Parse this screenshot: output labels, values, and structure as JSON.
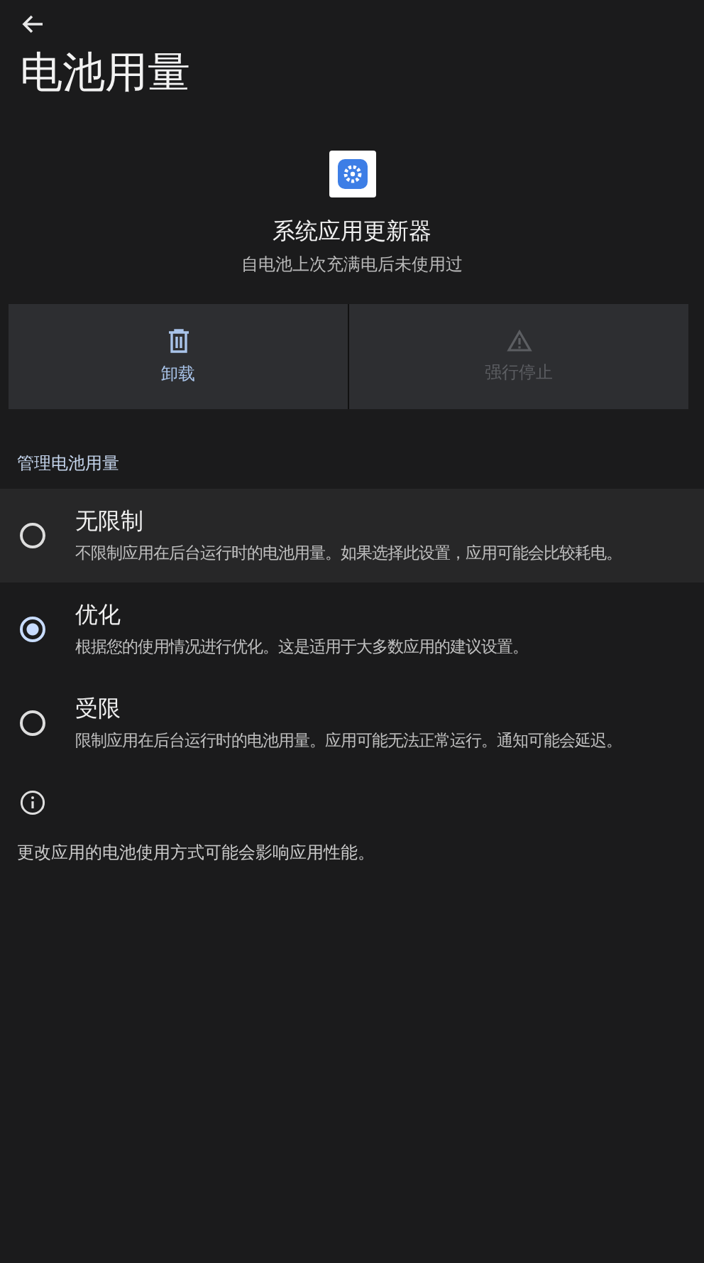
{
  "title": "电池用量",
  "app": {
    "name": "系统应用更新器",
    "subtitle": "自电池上次充满电后未使用过"
  },
  "actions": [
    {
      "kind": "uninstall",
      "label": "卸载",
      "disabled": false
    },
    {
      "kind": "force_stop",
      "label": "强行停止",
      "disabled": true
    }
  ],
  "section_title": "管理电池用量",
  "options": [
    {
      "title": "无限制",
      "description": "不限制应用在后台运行时的电池用量。如果选择此设置，应用可能会比较耗电。",
      "selected": false,
      "highlighted": true
    },
    {
      "title": "优化",
      "description": "根据您的使用情况进行优化。这是适用于大多数应用的建议设置。",
      "selected": true,
      "highlighted": false
    },
    {
      "title": "受限",
      "description": "限制应用在后台运行时的电池用量。应用可能无法正常运行。通知可能会延迟。",
      "selected": false,
      "highlighted": false
    }
  ],
  "footer": "更改应用的电池使用方式可能会影响应用性能。"
}
